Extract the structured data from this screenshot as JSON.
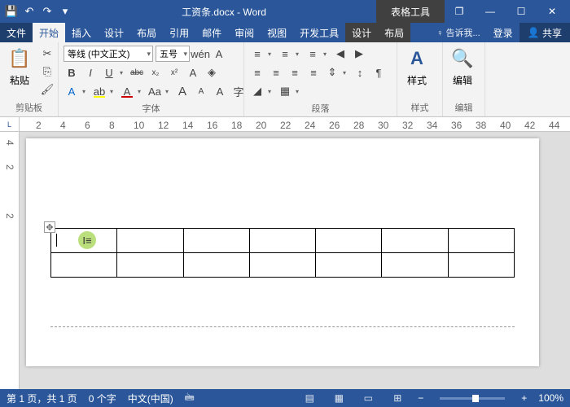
{
  "title": "工资条.docx - Word",
  "context_tab": "表格工具",
  "win": {
    "restore": "❐",
    "min": "—",
    "max": "☐",
    "close": "✕"
  },
  "qa": {
    "save": "💾",
    "undo": "↶",
    "redo": "↷",
    "more": "▾"
  },
  "tabs": {
    "file": "文件",
    "home": "开始",
    "insert": "插入",
    "design": "设计",
    "layout": "布局",
    "ref": "引用",
    "mail": "邮件",
    "review": "审阅",
    "view": "视图",
    "dev": "开发工具",
    "tdesign": "设计",
    "tlayout": "布局",
    "tell": "♀ 告诉我...",
    "login": "登录",
    "share": "共享"
  },
  "share_icon": "👤",
  "clipboard": {
    "label": "剪贴板",
    "paste": "粘贴",
    "paste_icon": "📋",
    "cut": "✂",
    "copy": "⎘",
    "painter": "🖌"
  },
  "font": {
    "label": "字体",
    "name": "等线 (中文正文)",
    "size": "五号",
    "pinyin": "wén",
    "border": "A",
    "clear": "◈",
    "b": "B",
    "i": "I",
    "u": "U",
    "strike": "abc",
    "sub": "x₂",
    "sup": "x²",
    "fx": "A",
    "hl": "ab",
    "color": "A",
    "aa": "Aa",
    "big": "A",
    "small": "A",
    "circ": "A",
    "char": "字"
  },
  "para": {
    "label": "段落",
    "bullets": "≡",
    "numbers": "≡",
    "multi": "≡",
    "dec": "◀",
    "inc": "▶",
    "sort": "↕",
    "marks": "¶",
    "al1": "≡",
    "al2": "≡",
    "al3": "≡",
    "al4": "≡",
    "space": "⇕",
    "shade": "◢",
    "bord": "▦"
  },
  "styles": {
    "label": "样式",
    "text": "样式",
    "icon": "A"
  },
  "edit": {
    "label": "编辑",
    "find": "🔍",
    "text": "编辑"
  },
  "ruler_h": [
    "2",
    "4",
    "6",
    "8",
    "10",
    "12",
    "14",
    "16",
    "18",
    "20",
    "22",
    "24",
    "26",
    "28",
    "30",
    "32",
    "34",
    "36",
    "38",
    "40",
    "42",
    "44"
  ],
  "ruler_v": [
    "4",
    "2",
    "",
    "2"
  ],
  "ruler_corner": "L",
  "status": {
    "page": "第 1 页，共 1 页",
    "words": "0 个字",
    "lang": "中文(中国)",
    "ime": "🖮",
    "v1": "▤",
    "v2": "▦",
    "v3": "▭",
    "v4": "⊞",
    "minus": "−",
    "plus": "+",
    "zoom": "100%"
  },
  "table_handle": "✥",
  "ibeam": "I≡"
}
